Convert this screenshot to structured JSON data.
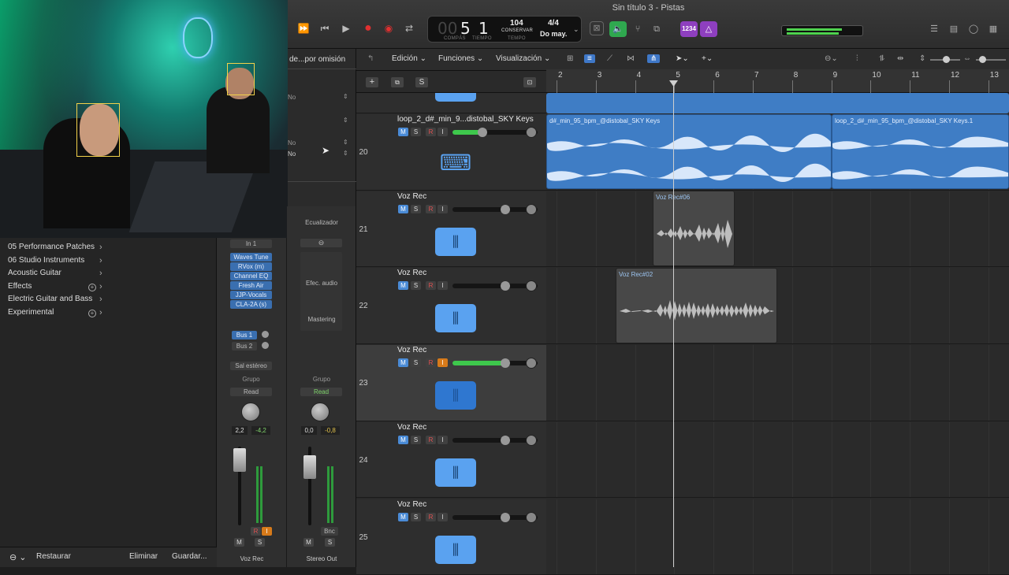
{
  "window": {
    "title": "Sin título 3 - Pistas"
  },
  "lcd": {
    "bar_prefix": "00",
    "bar": "5",
    "beat": "1",
    "bar_label": "COMPÁS",
    "beat_label": "TIEMPO",
    "tempo": "104",
    "tempo_sub": "CONSERVAR",
    "tempo_label": "TEMPO",
    "sig": "4/4",
    "key": "Do may."
  },
  "toolbar": {
    "count_in": "1234"
  },
  "inspector": {
    "preset_title": "de...por omisión",
    "opt1": "No",
    "opt2": "No",
    "opt3": "No"
  },
  "library": {
    "items": [
      {
        "label": "05 Performance Patches",
        "plus": false
      },
      {
        "label": "06 Studio Instruments",
        "plus": false
      },
      {
        "label": "Acoustic Guitar",
        "plus": false
      },
      {
        "label": "Effects",
        "plus": true
      },
      {
        "label": "Electric Guitar and Bass",
        "plus": false
      },
      {
        "label": "Experimental",
        "plus": true
      }
    ],
    "restore": "Restaurar",
    "delete": "Eliminar",
    "save": "Guardar..."
  },
  "strip1": {
    "input": "In 1",
    "plugins": [
      "Waves Tune",
      "RVox (m)",
      "Channel EQ",
      "Fresh Air",
      "JJP-Vocals",
      "CLA-2A (s)"
    ],
    "sends": [
      "Bus 1",
      "Bus 2"
    ],
    "output": "Sal estéreo",
    "group": "Grupo",
    "automation": "Read",
    "vol": "2,2",
    "peak": "-4,2",
    "m": "M",
    "s": "S",
    "r": "R",
    "i": "I",
    "name": "Voz Rec"
  },
  "strip2": {
    "eq": "Ecualizador",
    "audio_fx": "Efec. audio",
    "mastering": "Mastering",
    "group": "Grupo",
    "automation": "Read",
    "vol": "0,0",
    "peak": "-0,8",
    "bnc": "Bnc",
    "m": "M",
    "s": "S",
    "name": "Stereo Out"
  },
  "trackmenu": {
    "edit": "Edición",
    "functions": "Funciones",
    "view": "Visualización"
  },
  "header": {
    "s": "S"
  },
  "ruler": {
    "marks": [
      "2",
      "3",
      "4",
      "5",
      "6",
      "7",
      "8",
      "9",
      "10",
      "11",
      "12",
      "13"
    ]
  },
  "tracks": [
    {
      "num": "20",
      "name": "loop_2_d#_min_9...distobal_SKY Keys",
      "m": "M",
      "s": "S",
      "r": "R",
      "i": "I",
      "vol": 0.35,
      "icon": "keyboard-icon"
    },
    {
      "num": "21",
      "name": "Voz Rec",
      "m": "M",
      "s": "S",
      "r": "R",
      "i": "I",
      "vol": 0.62,
      "icon": "waveform-icon"
    },
    {
      "num": "22",
      "name": "Voz Rec",
      "m": "M",
      "s": "S",
      "r": "R",
      "i": "I",
      "vol": 0.62,
      "icon": "waveform-icon"
    },
    {
      "num": "23",
      "name": "Voz Rec",
      "m": "M",
      "s": "S",
      "r": "R",
      "i": "I",
      "vol": 0.62,
      "icon": "waveform-icon"
    },
    {
      "num": "24",
      "name": "Voz Rec",
      "m": "M",
      "s": "S",
      "r": "R",
      "i": "I",
      "vol": 0.62,
      "icon": "waveform-icon"
    },
    {
      "num": "25",
      "name": "Voz Rec",
      "m": "M",
      "s": "S",
      "r": "R",
      "i": "I",
      "vol": 0.62,
      "icon": "waveform-icon"
    }
  ],
  "regions": {
    "keys1": "d#_min_95_bpm_@distobal_SKY Keys",
    "keys2": "loop_2_d#_min_95_bpm_@distobal_SKY Keys.1",
    "voz06": "Voz Rec#06",
    "voz02": "Voz Rec#02"
  }
}
